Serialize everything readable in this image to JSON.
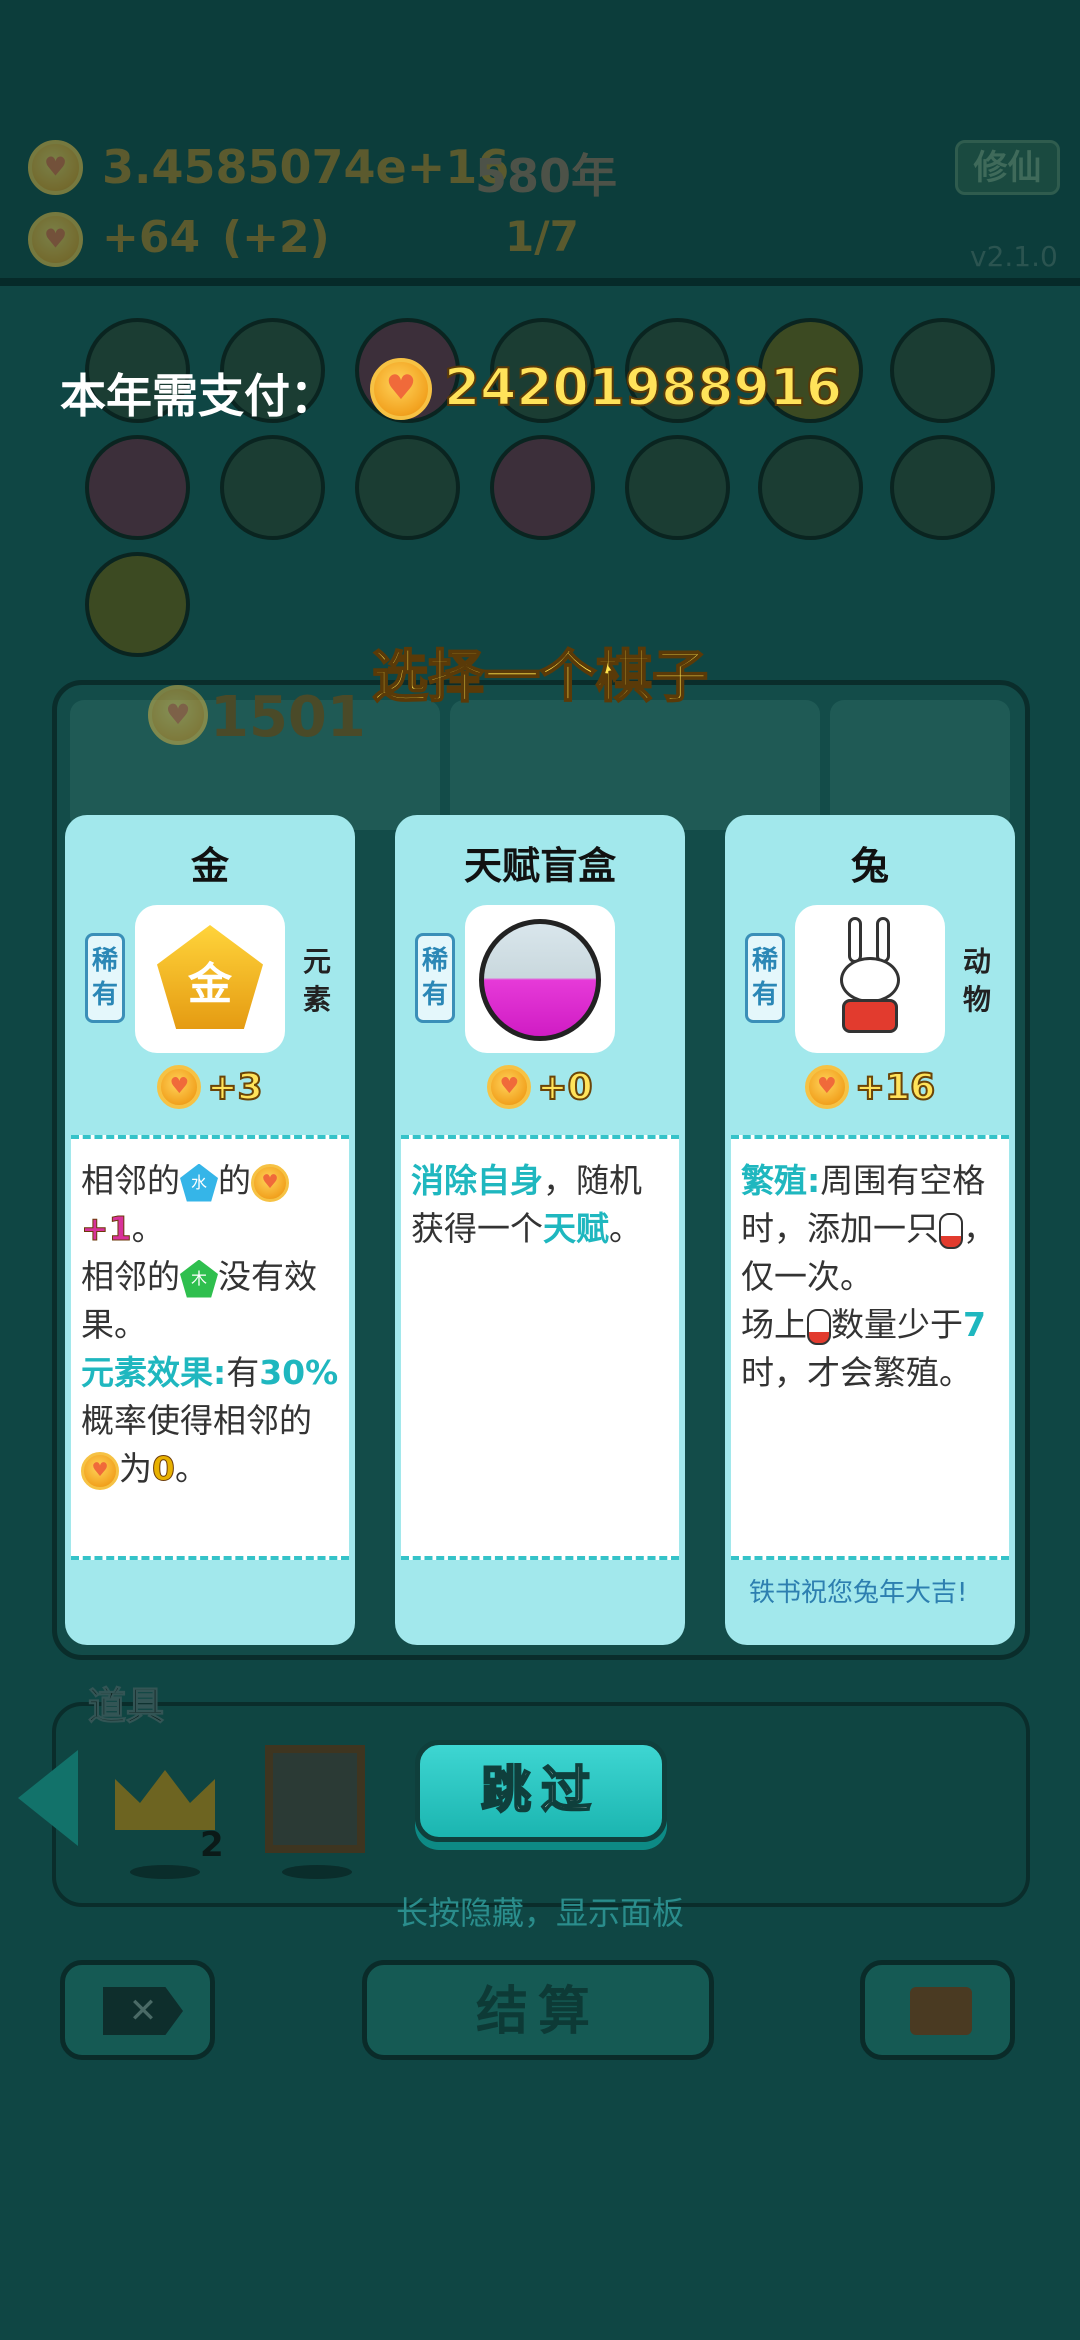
{
  "background": {
    "hud": {
      "coins": "3.4585074e+16",
      "year": "580年",
      "income": "+64",
      "income_bonus": "(+2)",
      "progress": "1/7",
      "cultivate_button": "修仙",
      "version": "v2.1.0"
    },
    "board_score": "1501",
    "tools_title": "道具",
    "crown_count": "2",
    "settle_button": "结算"
  },
  "payment": {
    "label": "本年需支付：",
    "amount": "24201988916"
  },
  "choose_title": "选择一个棋子",
  "cards": [
    {
      "name": "金",
      "rarity": "稀有",
      "type": "元素",
      "value": "+3",
      "desc": {
        "l1a": "相邻的",
        "water": "水",
        "l1b": "的",
        "l2num": "+1",
        "l2b": "。",
        "l3a": "相邻的",
        "wood": "木",
        "l3b": "没有效果。",
        "effect_label": "元素效果:",
        "effect_a": "有",
        "effect_pct": "30%",
        "effect_b": "概率使得相邻的",
        "effect_c": "为",
        "effect_zero": "0",
        "effect_end": "。"
      }
    },
    {
      "name": "天赋盲盒",
      "rarity": "稀有",
      "type": "",
      "value": "+0",
      "desc": {
        "a": "消除自身",
        "b": "，随机获得一个",
        "c": "天赋",
        "d": "。"
      }
    },
    {
      "name": "兔",
      "rarity": "稀有",
      "type": "动物",
      "value": "+16",
      "desc": {
        "label": "繁殖:",
        "a": "周围有空格时，添加一只",
        "b": "，仅一次。",
        "c": "场上",
        "d": "数量少于",
        "num": "7",
        "e": "时，才会繁殖。"
      },
      "flavor": "铁书祝您兔年大吉!"
    }
  ],
  "skip_button": "跳过",
  "hint": "长按隐藏，显示面板",
  "colors": {
    "accent": "#1fb7bf",
    "gold": "#ffe35a",
    "card_bg": "#a2e8ec"
  }
}
